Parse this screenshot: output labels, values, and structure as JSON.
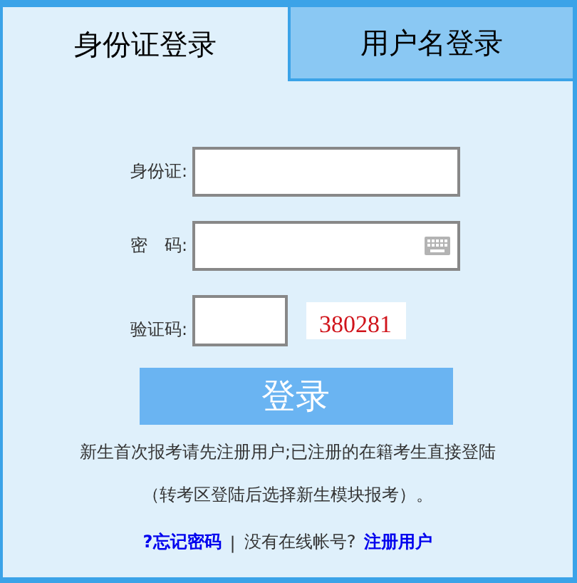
{
  "tabs": [
    {
      "label": "身份证登录",
      "selected": true
    },
    {
      "label": "用户名登录",
      "selected": false
    }
  ],
  "fields": [
    {
      "kind": "text",
      "label": "身份证:"
    },
    {
      "kind": "password",
      "label": "密　码:"
    },
    {
      "kind": "captcha",
      "label": "验证码:",
      "captcha": "380281"
    }
  ],
  "login_button": "登录",
  "notice": [
    "新生首次报考请先注册用户;已注册的在籍考生直接登陆",
    "（转考区登陆后选择新生模块报考）。"
  ],
  "links": {
    "forgot": "?忘记密码",
    "separator": "|",
    "question": "没有在线帐号?",
    "register": "注册用户"
  }
}
